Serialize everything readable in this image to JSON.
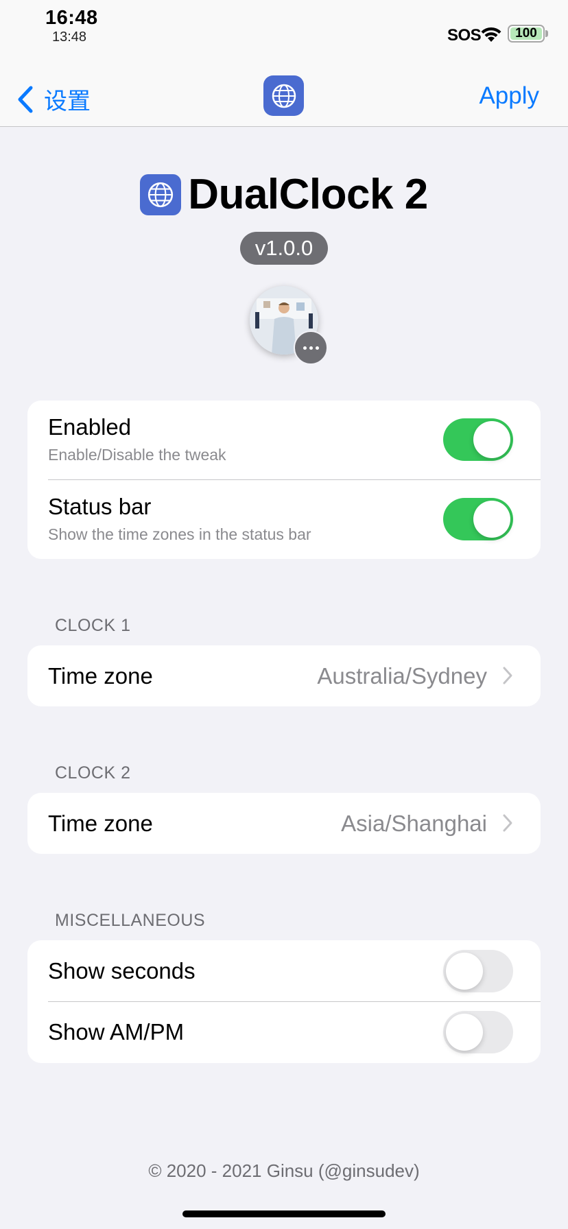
{
  "status_bar": {
    "time": "16:48",
    "secondary_time": "13:48",
    "carrier": "SOS",
    "battery": "100"
  },
  "nav": {
    "back_label": "设置",
    "apply_label": "Apply"
  },
  "header": {
    "title": "DualClock 2",
    "version": "v1.0.0"
  },
  "groups": {
    "main": {
      "rows": [
        {
          "title": "Enabled",
          "subtitle": "Enable/Disable the tweak",
          "toggle": true
        },
        {
          "title": "Status bar",
          "subtitle": "Show the time zones in the status bar",
          "toggle": true
        }
      ]
    },
    "clock1": {
      "header": "CLOCK 1",
      "rows": [
        {
          "title": "Time zone",
          "value": "Australia/Sydney"
        }
      ]
    },
    "clock2": {
      "header": "CLOCK 2",
      "rows": [
        {
          "title": "Time zone",
          "value": "Asia/Shanghai"
        }
      ]
    },
    "misc": {
      "header": "MISCELLANEOUS",
      "rows": [
        {
          "title": "Show seconds",
          "toggle": false
        },
        {
          "title": "Show AM/PM",
          "toggle": false
        }
      ]
    }
  },
  "footer": "© 2020 - 2021 Ginsu (@ginsudev)",
  "colors": {
    "accent": "#0a7aff",
    "toggle_on": "#34c759",
    "toggle_off": "#e9e9eb",
    "app_icon": "#4a6bd0"
  },
  "icons": [
    "chevron-left-icon",
    "globe-clock-icon",
    "wifi-icon",
    "battery-icon",
    "chevron-right-icon",
    "more-icon"
  ]
}
